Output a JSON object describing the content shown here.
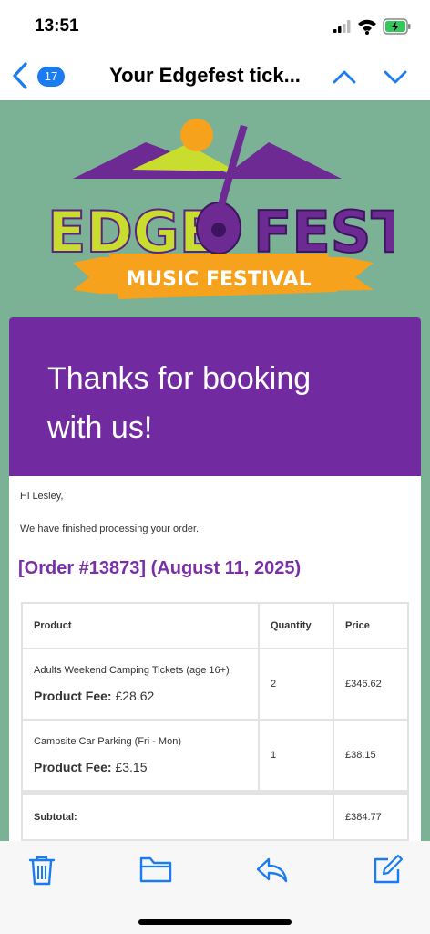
{
  "status_bar": {
    "time": "13:51"
  },
  "nav": {
    "unread_count": "17",
    "title": "Your Edgefest tick..."
  },
  "logo": {
    "line1_left": "EDGE",
    "line1_right": "FEST",
    "banner": "MUSIC FESTIVAL"
  },
  "email": {
    "hero_text": "Thanks for booking with us!",
    "greeting": "Hi Lesley,",
    "intro": "We have finished processing your order.",
    "order_heading": "[Order #13873] (August 11, 2025)",
    "table": {
      "headers": [
        "Product",
        "Quantity",
        "Price"
      ],
      "rows": [
        {
          "product": "Adults Weekend Camping Tickets (age 16+)",
          "fee_label": "Product Fee:",
          "fee_value": "£28.62",
          "quantity": "2",
          "price": "£346.62"
        },
        {
          "product": "Campsite Car Parking (Fri - Mon)",
          "fee_label": "Product Fee:",
          "fee_value": "£3.15",
          "quantity": "1",
          "price": "£38.15"
        }
      ],
      "subtotal_label": "Subtotal:",
      "subtotal_value": "£384.77"
    }
  },
  "colors": {
    "accent": "#1a7cf0",
    "hero": "#722aa0",
    "order_heading": "#7a2fa8",
    "background": "#7bb195"
  },
  "toolbar": {
    "icons": [
      "trash-icon",
      "folder-icon",
      "reply-icon",
      "compose-icon"
    ]
  }
}
